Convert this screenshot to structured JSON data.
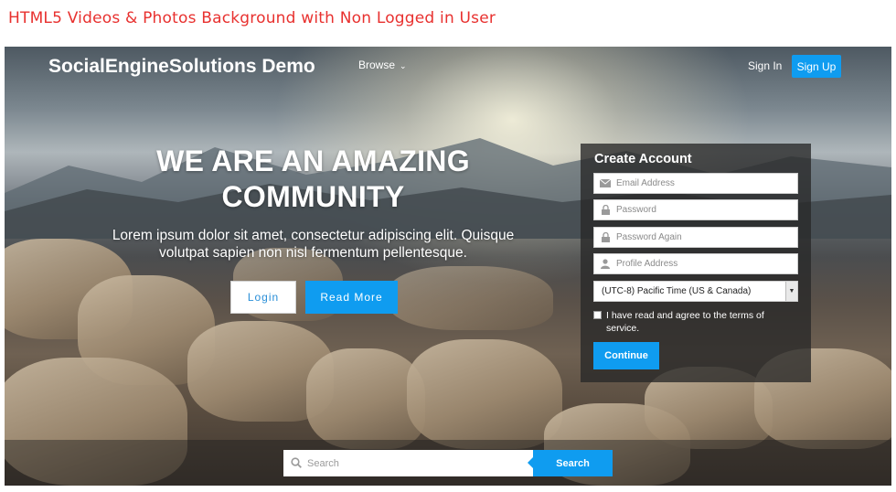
{
  "caption": "HTML5 Videos & Photos Background with Non Logged in User",
  "header": {
    "brand": "SocialEngineSolutions Demo",
    "browse_label": "Browse",
    "signin_label": "Sign In",
    "signup_label": "Sign Up"
  },
  "hero": {
    "title": "WE ARE AN AMAZING COMMUNITY",
    "subtitle": "Lorem ipsum dolor sit amet, consectetur adipiscing elit. Quisque volutpat sapien non nisl fermentum pellentesque.",
    "login_label": "Login",
    "readmore_label": "Read More"
  },
  "signup_form": {
    "title": "Create Account",
    "email_placeholder": "Email Address",
    "password_placeholder": "Password",
    "password_again_placeholder": "Password Again",
    "profile_placeholder": "Profile Address",
    "timezone_value": "(UTC-8) Pacific Time (US & Canada)",
    "terms_text": "I have read and agree to the terms of service.",
    "continue_label": "Continue"
  },
  "search": {
    "placeholder": "Search",
    "button_label": "Search"
  },
  "colors": {
    "accent": "#0f9cf0",
    "caption": "#e8312f"
  }
}
